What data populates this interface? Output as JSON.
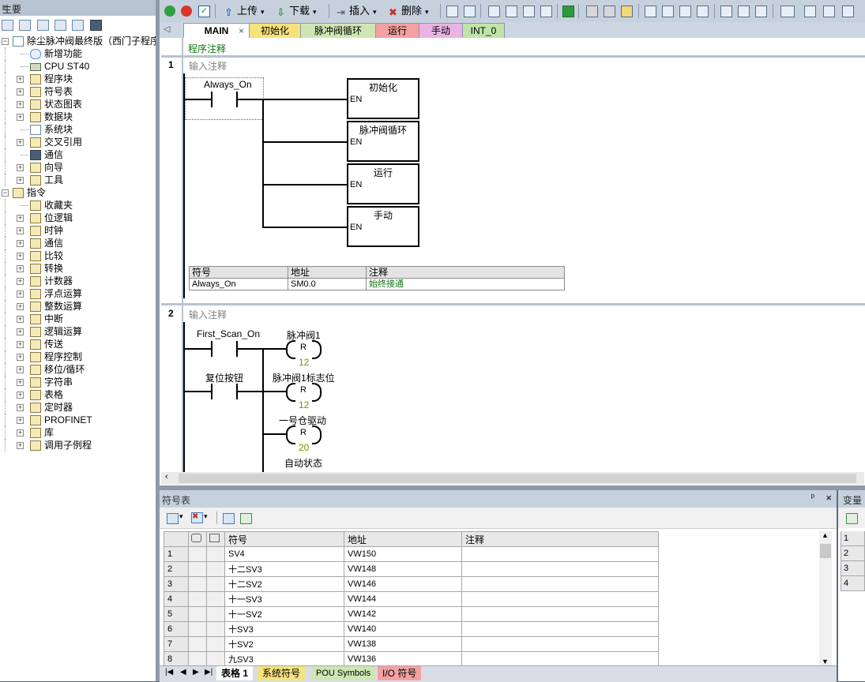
{
  "left_panel": {
    "title": "主要",
    "pin": "ᵖ",
    "project": "除尘脉冲阀最终版（西门子程序",
    "project_items": [
      {
        "label": "新增功能",
        "icon": "help-icon",
        "expandable": false
      },
      {
        "label": "CPU ST40",
        "icon": "cpu-icon",
        "expandable": false
      },
      {
        "label": "程序块",
        "icon": "folder-icon",
        "expandable": true
      },
      {
        "label": "符号表",
        "icon": "folder-icon",
        "expandable": true
      },
      {
        "label": "状态图表",
        "icon": "folder-icon",
        "expandable": true
      },
      {
        "label": "数据块",
        "icon": "folder-icon",
        "expandable": true
      },
      {
        "label": "系统块",
        "icon": "config-icon",
        "expandable": false
      },
      {
        "label": "交叉引用",
        "icon": "folder-icon",
        "expandable": true
      },
      {
        "label": "通信",
        "icon": "monitor-icon",
        "expandable": false
      },
      {
        "label": "向导",
        "icon": "wand-icon",
        "expandable": true
      },
      {
        "label": "工具",
        "icon": "folder-icon",
        "expandable": true
      }
    ],
    "instructions_label": "指令",
    "instruction_items": [
      "收藏夹",
      "位逻辑",
      "时钟",
      "通信",
      "比较",
      "转换",
      "计数器",
      "浮点运算",
      "整数运算",
      "中断",
      "逻辑运算",
      "传送",
      "程序控制",
      "移位/循环",
      "字符串",
      "表格",
      "定时器",
      "PROFINET",
      "库",
      "调用子例程"
    ]
  },
  "toolbar": {
    "upload_label": "上传",
    "download_label": "下载",
    "insert_label": "插入",
    "delete_label": "删除"
  },
  "tabs": [
    {
      "label": "MAIN",
      "active": true,
      "color": "#ffffff"
    },
    {
      "label": "初始化",
      "color": "#f6e27a"
    },
    {
      "label": "脉冲阀循环",
      "color": "#cfe6b4"
    },
    {
      "label": "运行",
      "color": "#f3a1a1"
    },
    {
      "label": "手动",
      "color": "#e9b4e3"
    },
    {
      "label": "INT_0",
      "color": "#bfe4a9"
    }
  ],
  "tab_close": "×",
  "tab_scroll": "◁",
  "editor": {
    "program_comment": "程序注释",
    "networks": [
      {
        "number": "1",
        "comment": "输入注释",
        "contact": "Always_On",
        "blocks": [
          "初始化",
          "脉冲阀循环",
          "运行",
          "手动"
        ],
        "en_label": "EN",
        "symbol_table": {
          "headers": [
            "符号",
            "地址",
            "注释"
          ],
          "rows": [
            [
              "Always_On",
              "SM0.0",
              "始终接通"
            ]
          ]
        }
      },
      {
        "number": "2",
        "comment": "输入注释",
        "contacts": [
          "First_Scan_On",
          "复位按钮"
        ],
        "coils": [
          {
            "name": "脉冲阀1",
            "type": "R",
            "value": "12"
          },
          {
            "name": "脉冲阀1标志位",
            "type": "R",
            "value": "12"
          },
          {
            "name": "一号仓驱动",
            "type": "R",
            "value": "20"
          },
          {
            "name": "自动状态",
            "type": "R",
            "value": ""
          }
        ]
      }
    ]
  },
  "symbol_panel": {
    "title": "符号表",
    "pin": "ᵖ",
    "close": "×",
    "headers": [
      "符号",
      "地址",
      "注释"
    ],
    "rows": [
      {
        "n": "1",
        "symbol": "SV4",
        "address": "VW150",
        "comment": ""
      },
      {
        "n": "2",
        "symbol": "十二SV3",
        "address": "VW148",
        "comment": ""
      },
      {
        "n": "3",
        "symbol": "十二SV2",
        "address": "VW146",
        "comment": ""
      },
      {
        "n": "4",
        "symbol": "十一SV3",
        "address": "VW144",
        "comment": ""
      },
      {
        "n": "5",
        "symbol": "十一SV2",
        "address": "VW142",
        "comment": ""
      },
      {
        "n": "6",
        "symbol": "十SV3",
        "address": "VW140",
        "comment": ""
      },
      {
        "n": "7",
        "symbol": "十SV2",
        "address": "VW138",
        "comment": ""
      },
      {
        "n": "8",
        "symbol": "九SV3",
        "address": "VW136",
        "comment": ""
      }
    ],
    "sheets": [
      {
        "label": "表格 1",
        "color": "#ffffff",
        "active": true
      },
      {
        "label": "系统符号",
        "color": "#f6e27a"
      },
      {
        "label": "POU Symbols",
        "color": "#cfe6b4"
      },
      {
        "label": "I/O 符号",
        "color": "#f3a1a1"
      }
    ],
    "nav": [
      "|◀",
      "◀",
      "▶",
      "▶|"
    ]
  },
  "var_panel": {
    "title": "变量",
    "rows": [
      "1",
      "2",
      "3",
      "4"
    ]
  }
}
